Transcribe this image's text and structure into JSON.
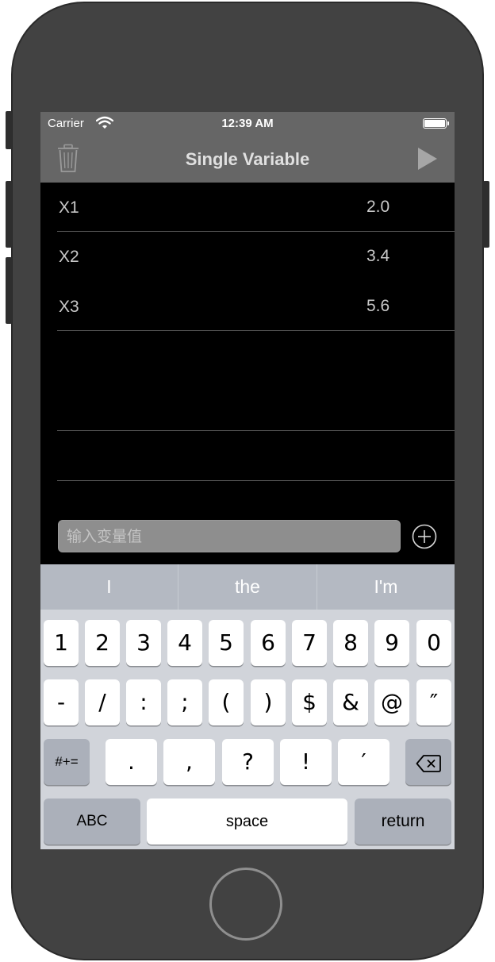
{
  "status_bar": {
    "carrier": "Carrier",
    "time": "12:39 AM"
  },
  "nav": {
    "title": "Single Variable",
    "trash_icon": "trash-icon",
    "play_icon": "play-icon"
  },
  "rows": [
    {
      "name": "X1",
      "value": "2.0"
    },
    {
      "name": "X2",
      "value": "3.4"
    },
    {
      "name": "X3",
      "value": "5.6"
    }
  ],
  "input": {
    "placeholder": "输入变量值",
    "value": ""
  },
  "add_icon": "plus-circle-icon",
  "suggestions": [
    "I",
    "the",
    "I'm"
  ],
  "keys": {
    "row1": [
      "1",
      "2",
      "3",
      "4",
      "5",
      "6",
      "7",
      "8",
      "9",
      "0"
    ],
    "row2": [
      "-",
      "/",
      ":",
      ";",
      "(",
      ")",
      "$",
      "&",
      "@",
      "″"
    ],
    "row3_left": "#+=",
    "row3": [
      ".",
      ",",
      "?",
      "!",
      "′"
    ],
    "delete_icon": "backspace-icon",
    "abc": "ABC",
    "space": "space",
    "return": "return"
  }
}
